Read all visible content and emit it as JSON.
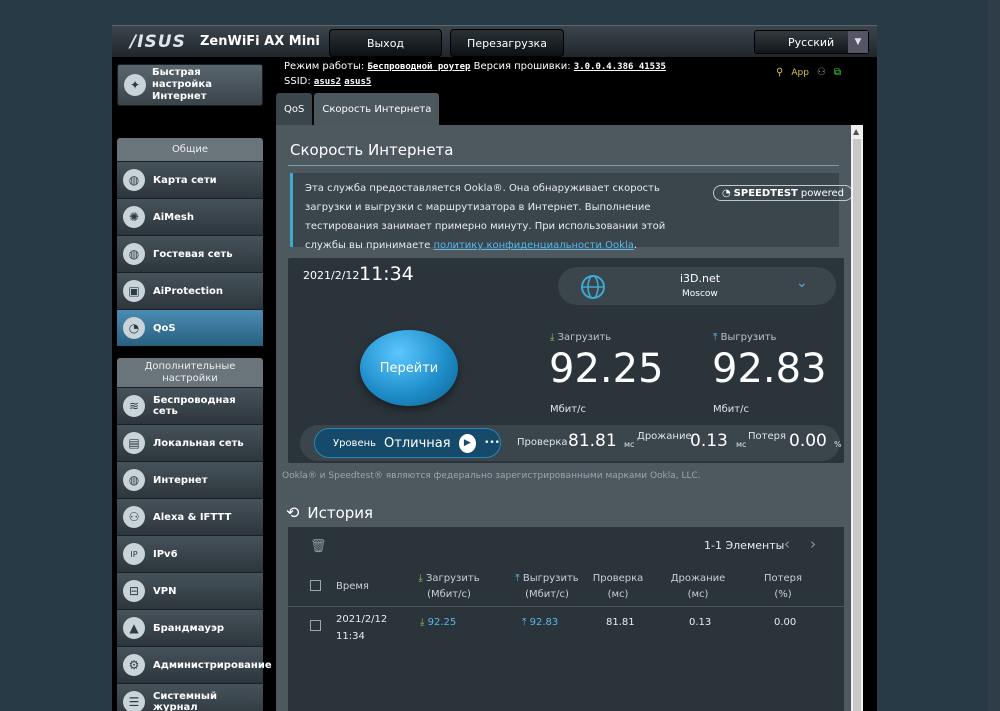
{
  "header": {
    "logo": "/ISUS",
    "product": "ZenWiFi AX Mini",
    "logout_label": "Выход",
    "reboot_label": "Перезагрузка",
    "language": "Русский"
  },
  "info": {
    "mode_label": "Режим работы:",
    "mode_value": "Беспроводной роутер",
    "fw_label": "Версия прошивки:",
    "fw_value": "3.0.0.4.386_41535",
    "ssid_label": "SSID:",
    "ssid_1": "asus2",
    "ssid_2": "asus5",
    "app_label": "App"
  },
  "sidebar": {
    "quick_setup": "Быстрая настройка Интернет",
    "section_general": "Общие",
    "general_items": [
      {
        "label": "Карта сети",
        "icon": "globe-icon"
      },
      {
        "label": "AiMesh",
        "icon": "mesh-icon"
      },
      {
        "label": "Гостевая сеть",
        "icon": "globe-icon"
      },
      {
        "label": "AiProtection",
        "icon": "lock-icon"
      },
      {
        "label": "QoS",
        "icon": "gauge-icon"
      }
    ],
    "section_advanced": "Дополнительные настройки",
    "advanced_items": [
      {
        "label": "Беспроводная сеть",
        "icon": "wifi-icon"
      },
      {
        "label": "Локальная сеть",
        "icon": "lan-icon"
      },
      {
        "label": "Интернет",
        "icon": "globe-icon"
      },
      {
        "label": "Alexa & IFTTT",
        "icon": "people-icon"
      },
      {
        "label": "IPv6",
        "icon": "ipv6-icon"
      },
      {
        "label": "VPN",
        "icon": "vpn-icon"
      },
      {
        "label": "Брандмауэр",
        "icon": "fire-icon"
      },
      {
        "label": "Администрирование",
        "icon": "gear-icon"
      },
      {
        "label": "Системный журнал",
        "icon": "log-icon"
      }
    ]
  },
  "tabs": [
    "QoS",
    "Скорость Интернета"
  ],
  "main": {
    "title": "Скорость Интернета",
    "notice_text": "Эта служба предоставляется Ookla®. Она обнаруживает скорость загрузки и выгрузки с маршрутизатора в Интернет. Выполнение тестирования занимает примерно минуту. При использовании этой службы вы принимаете ",
    "notice_link": "политику конфиденциальности Ookla",
    "notice_end": ".",
    "speedtest_bold": "SPEEDTEST",
    "speedtest_light": "powered",
    "date": "2021/2/12",
    "time": "11:34",
    "server_name": "i3D.net",
    "server_city": "Moscow",
    "go_label": "Перейти",
    "download_label": "Загрузить",
    "upload_label": "Выгрузить",
    "download_value": "92.25",
    "upload_value": "92.83",
    "unit_mbps": "Мбит/с",
    "player_l1": "Уровень",
    "player_l2": "Отличная",
    "ping_label": "Проверка",
    "ping_value": "81.81",
    "ping_unit": "мс",
    "jitter_label": "Дрожание",
    "jitter_value": "0.13",
    "jitter_unit": "мс",
    "loss_label": "Потеря",
    "loss_value": "0.00",
    "loss_unit": "%",
    "trademark": "Ookla® и Speedtest® являются федерально зарегистрированными марками Ookla, LLC."
  },
  "history": {
    "title": "История",
    "pager": "1-1 Элементы",
    "columns": {
      "time": "Время",
      "down_1": "Загрузить",
      "down_2": "(Мбит/с)",
      "up_1": "Выгрузить",
      "up_2": "(Мбит/с)",
      "ping_1": "Проверка",
      "ping_2": "(мс)",
      "jitter_1": "Дрожание",
      "jitter_2": "(мс)",
      "loss_1": "Потеря",
      "loss_2": "(%)"
    },
    "rows": [
      {
        "date": "2021/2/12",
        "time": "11:34",
        "down": "92.25",
        "up": "92.83",
        "ping": "81.81",
        "jitter": "0.13",
        "loss": "0.00"
      }
    ]
  },
  "colors": {
    "accent": "#3fa9d6",
    "link": "#56b8ec",
    "active_nav": "#28607f"
  }
}
